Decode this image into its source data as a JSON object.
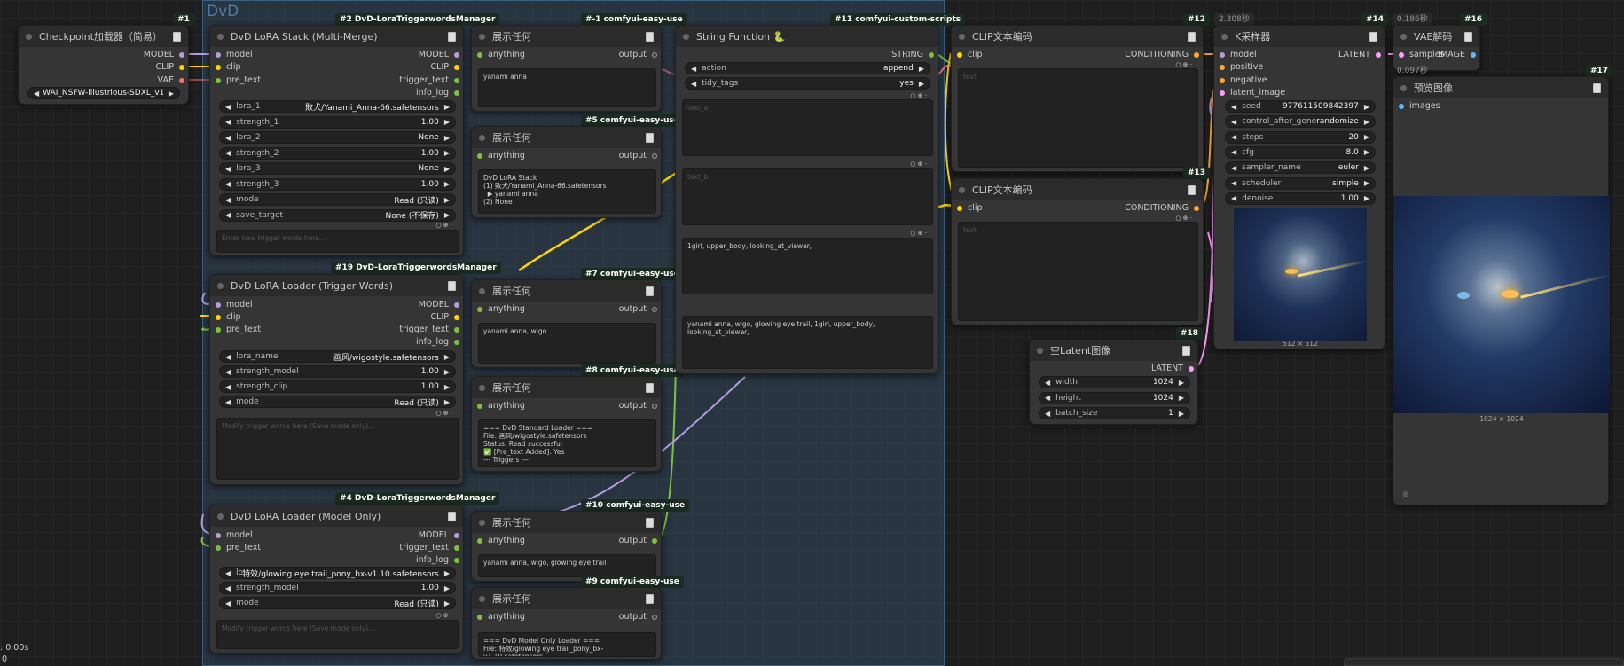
{
  "group": {
    "title": "DvD"
  },
  "badges": {
    "n1": "#1",
    "n2": "#2 DvD-LoraTriggerwordsManager",
    "n1b": "#-1 comfyui-easy-use",
    "n11": "#11 comfyui-custom-scripts",
    "n12": "#12",
    "n13": "#13",
    "n14": "#14",
    "n16": "#16",
    "n17": "#17",
    "n18": "#18",
    "n19": "#19 DvD-LoraTriggerwordsManager",
    "n4": "#4 DvD-LoraTriggerwordsManager",
    "n5": "#5 comfyui-easy-use",
    "n7": "#7 comfyui-easy-use",
    "n8": "#8 comfyui-easy-use",
    "n9": "#9 comfyui-easy-use",
    "n10": "#10 comfyui-easy-use",
    "t14": "2.308秒",
    "t16": "0.186秒",
    "t16b": "0.097秒"
  },
  "ckpt": {
    "title": "Checkpoint加载器（简易）",
    "model": "MODEL",
    "clip": "CLIP",
    "vae": "VAE",
    "ckpt_name": "WAI_NSFW-illustrious-SDXL_v1 ..."
  },
  "stack": {
    "title": "DvD LoRA Stack (Multi-Merge)",
    "in_model": "model",
    "in_clip": "clip",
    "in_pre": "pre_text",
    "out_model": "MODEL",
    "out_clip": "CLIP",
    "out_trigger": "trigger_text",
    "out_info": "info_log",
    "widgets": [
      {
        "label": "lora_1",
        "value": "敗犬/Yanami_Anna-66.safetensors"
      },
      {
        "label": "strength_1",
        "value": "1.00"
      },
      {
        "label": "lora_2",
        "value": "None"
      },
      {
        "label": "strength_2",
        "value": "1.00"
      },
      {
        "label": "lora_3",
        "value": "None"
      },
      {
        "label": "strength_3",
        "value": "1.00"
      },
      {
        "label": "mode",
        "value": "Read (只读)"
      },
      {
        "label": "save_target",
        "value": "None (不保存)"
      }
    ],
    "placeholder": "Enter new trigger words here..."
  },
  "tw": {
    "title": "DvD LoRA Loader (Trigger Words)",
    "in_model": "model",
    "in_clip": "clip",
    "in_pre": "pre_text",
    "out_model": "MODEL",
    "out_clip": "CLIP",
    "out_trigger": "trigger_text",
    "out_info": "info_log",
    "widgets": [
      {
        "label": "lora_name",
        "value": "画风/wigostyle.safetensors"
      },
      {
        "label": "strength_model",
        "value": "1.00"
      },
      {
        "label": "strength_clip",
        "value": "1.00"
      },
      {
        "label": "mode",
        "value": "Read (只读)"
      }
    ],
    "placeholder": "Modify trigger words here (Save mode only)..."
  },
  "mo": {
    "title": "DvD LoRA Loader (Model Only)",
    "in_model": "model",
    "in_pre": "pre_text",
    "out_model": "MODEL",
    "out_trigger": "trigger_text",
    "out_info": "info_log",
    "widgets": [
      {
        "label": "lora_n ...",
        "value": "特效/glowing eye trail_pony_bx-v1.10.safetensors"
      },
      {
        "label": "strength_model",
        "value": "1.00"
      },
      {
        "label": "mode",
        "value": "Read (只读)"
      }
    ],
    "placeholder": "Modify trigger words here (Save mode only)..."
  },
  "show": {
    "title": "展示任何",
    "in": "anything",
    "out": "output",
    "t1": "yanami anna",
    "t5": "DvD LoRA Stack\n(1) 敗犬/Yanami_Anna-66.safetensors\n  ▶ yanami anna\n(2) None",
    "t7": "yanami anna, wigo",
    "t8": "=== DvD Standard Loader ===\nFile: 画风/wigostyle.safetensors\nStatus: Read successful\n✅ [Pre_text Added]: Yes\n--- Triggers ---\nwigo",
    "t10": "yanami anna, wigo, glowing eye trail",
    "t9": "=== DvD Model Only Loader ===\nFile: 特效/glowing eye trail_pony_bx-v1.10.safetensors\n✅ [Pre_text Added]"
  },
  "sf": {
    "title": "String Function 🐍",
    "out": "STRING",
    "action_label": "action",
    "action_value": "append",
    "tidy_label": "tidy_tags",
    "tidy_value": "yes",
    "ph_a": "text_a",
    "ph_b": "text_b",
    "text_c": "1girl, upper_body, looking_at_viewer,",
    "result": "yanami anna, wigo, glowing eye trail, 1girl, upper_body, looking_at_viewer,"
  },
  "clip1": {
    "title": "CLIP文本编码",
    "in": "clip",
    "out": "CONDITIONING",
    "ph": "text"
  },
  "clip2": {
    "title": "CLIP文本编码",
    "in": "clip",
    "out": "CONDITIONING",
    "ph": "text"
  },
  "ks": {
    "title": "K采样器",
    "in_model": "model",
    "in_pos": "positive",
    "in_neg": "negative",
    "in_lat": "latent_image",
    "out": "LATENT",
    "widgets": [
      {
        "label": "seed",
        "value": "977611509842397"
      },
      {
        "label": "control_after_generate",
        "value": "randomize"
      },
      {
        "label": "steps",
        "value": "20"
      },
      {
        "label": "cfg",
        "value": "8.0"
      },
      {
        "label": "sampler_name",
        "value": "euler"
      },
      {
        "label": "scheduler",
        "value": "simple"
      },
      {
        "label": "denoise",
        "value": "1.00"
      }
    ],
    "size": "512 × 512"
  },
  "vae": {
    "title": "VAE解码",
    "in": "samples",
    "out": "IMAGE"
  },
  "prev": {
    "title": "预览图像",
    "in": "images",
    "size": "1024 × 1024"
  },
  "lat": {
    "title": "空Latent图像",
    "out": "LATENT",
    "widgets": [
      {
        "label": "width",
        "value": "1024"
      },
      {
        "label": "height",
        "value": "1024"
      },
      {
        "label": "batch_size",
        "value": "1"
      }
    ]
  },
  "status": {
    "time": ": 0.00s",
    "count": "0"
  },
  "colors": {
    "model": "#b39ddb",
    "clip": "#ffd500",
    "vae": "#ff6e6e",
    "string": "#7cc142",
    "cond": "#ffa931",
    "latent": "#ff9cf9",
    "image": "#64b5f6"
  }
}
